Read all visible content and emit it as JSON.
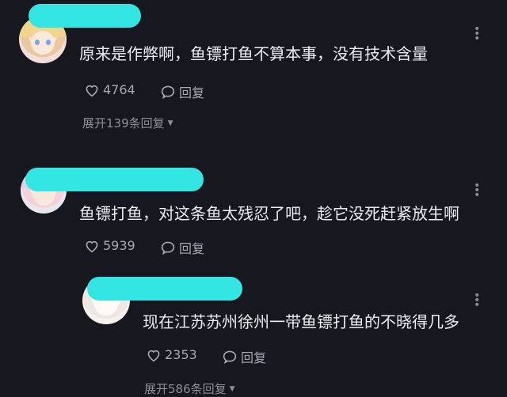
{
  "comments": [
    {
      "text": "原来是作弊啊，鱼镖打鱼不算本事，没有技术含量",
      "likes": "4764",
      "reply_label": "回复",
      "expand_label": "展开139条回复"
    },
    {
      "text": "鱼镖打鱼，对这条鱼太残忍了吧，趁它没死赶紧放生啊",
      "likes": "5939",
      "reply_label": "回复",
      "replies": [
        {
          "text": "现在江苏苏州徐州一带鱼镖打鱼的不晓得几多",
          "likes": "2353",
          "reply_label": "回复"
        }
      ],
      "expand_label": "展开586条回复"
    }
  ],
  "icons": {
    "like": "heart-outline-icon",
    "reply": "speech-bubble-icon",
    "more": "more-dots-icon",
    "expand": "caret-down-icon"
  },
  "colors": {
    "background": "#17171f",
    "redaction": "#33e6e4",
    "text": "#ececf0",
    "meta": "#a9a9b2"
  }
}
